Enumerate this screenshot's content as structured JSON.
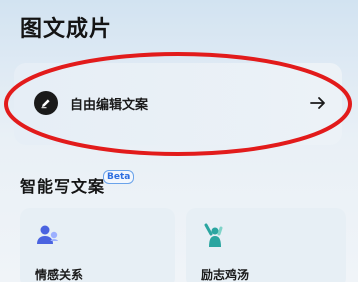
{
  "header": {
    "title": "图文成片"
  },
  "edit_card": {
    "label": "自由编辑文案",
    "icon": "pencil-icon",
    "action_icon": "arrow-right-icon"
  },
  "section": {
    "title": "智能写文案",
    "badge": "Beta"
  },
  "categories": [
    {
      "label": "情感关系",
      "icon": "people-icon"
    },
    {
      "label": "励志鸡汤",
      "icon": "cheering-person-icon"
    }
  ],
  "colors": {
    "annotation_oval": "#e21b1b",
    "icon_blue": "#4a63e0",
    "icon_teal": "#2aa5a0"
  }
}
